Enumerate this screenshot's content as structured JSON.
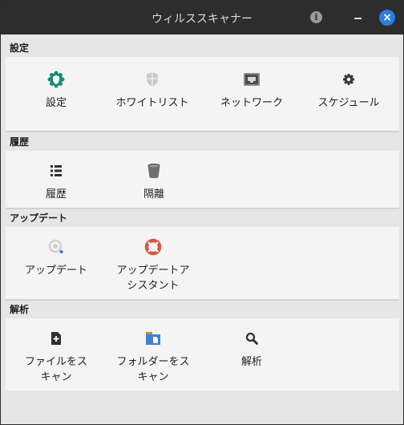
{
  "window": {
    "title": "ウィルススキャナー"
  },
  "sections": {
    "settings": {
      "header": "設定",
      "items": [
        {
          "label": "設定",
          "icon": "shield-settings-icon"
        },
        {
          "label": "ホワイトリスト",
          "icon": "shield-whitelist-icon"
        },
        {
          "label": "ネットワーク",
          "icon": "network-port-icon"
        },
        {
          "label": "スケジュール",
          "icon": "gear-icon"
        }
      ]
    },
    "history": {
      "header": "履歴",
      "items": [
        {
          "label": "履歴",
          "icon": "list-icon"
        },
        {
          "label": "隔離",
          "icon": "trash-bin-icon"
        }
      ]
    },
    "update": {
      "header": "アップデート",
      "items": [
        {
          "label": "アップデート",
          "icon": "update-icon"
        },
        {
          "label": "アップデートア\nシスタント",
          "icon": "lifebuoy-icon"
        }
      ]
    },
    "analysis": {
      "header": "解析",
      "items": [
        {
          "label": "ファイルをス\nキャン",
          "icon": "file-add-icon"
        },
        {
          "label": "フォルダーをス\nキャン",
          "icon": "folder-icon"
        },
        {
          "label": "解析",
          "icon": "search-icon"
        }
      ]
    }
  },
  "colors": {
    "titlebar": "#2d2d2d",
    "close_button": "#2a7de1",
    "accent_green": "#1b8a75",
    "lifebuoy_red": "#e0533f"
  }
}
